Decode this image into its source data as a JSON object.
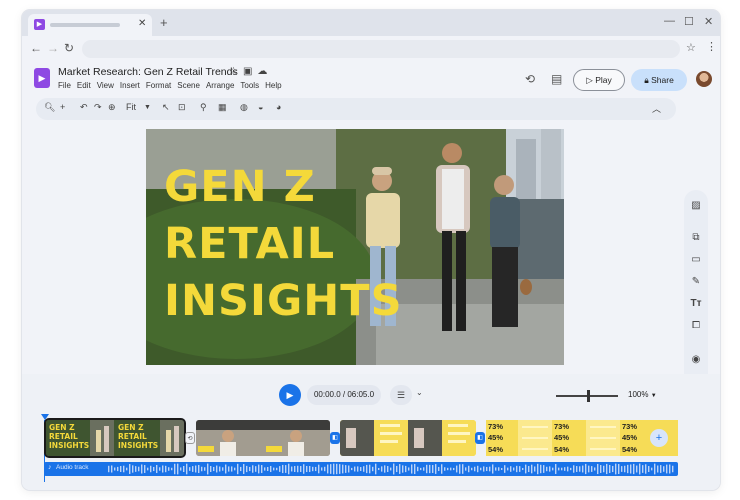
{
  "document": {
    "title": "Market Research: Gen Z Retail Trends",
    "menu": [
      "File",
      "Edit",
      "View",
      "Insert",
      "Format",
      "Scene",
      "Arrange",
      "Tools",
      "Help"
    ]
  },
  "header": {
    "play_label": "Play",
    "share_label": "Share"
  },
  "toolbar": {
    "zoom_label": "Fit"
  },
  "slide": {
    "title_lines": [
      "GEN Z",
      "RETAIL",
      "INSIGHTS"
    ]
  },
  "playback": {
    "timecode": "00:00.0 / 06:05.0",
    "zoom_percent": "100%",
    "zoom_level": 0.5
  },
  "timeline": {
    "clip_title_lines": [
      "GEN Z",
      "RETAIL",
      "INSIGHTS"
    ],
    "stat_values": [
      "73%",
      "45%",
      "54%"
    ],
    "audio_label": "Audio track"
  },
  "colors": {
    "accent": "#1a73e8",
    "brand": "#8e49e3",
    "title_yellow": "#f4d93a",
    "share_bg": "#c9e0fb"
  }
}
